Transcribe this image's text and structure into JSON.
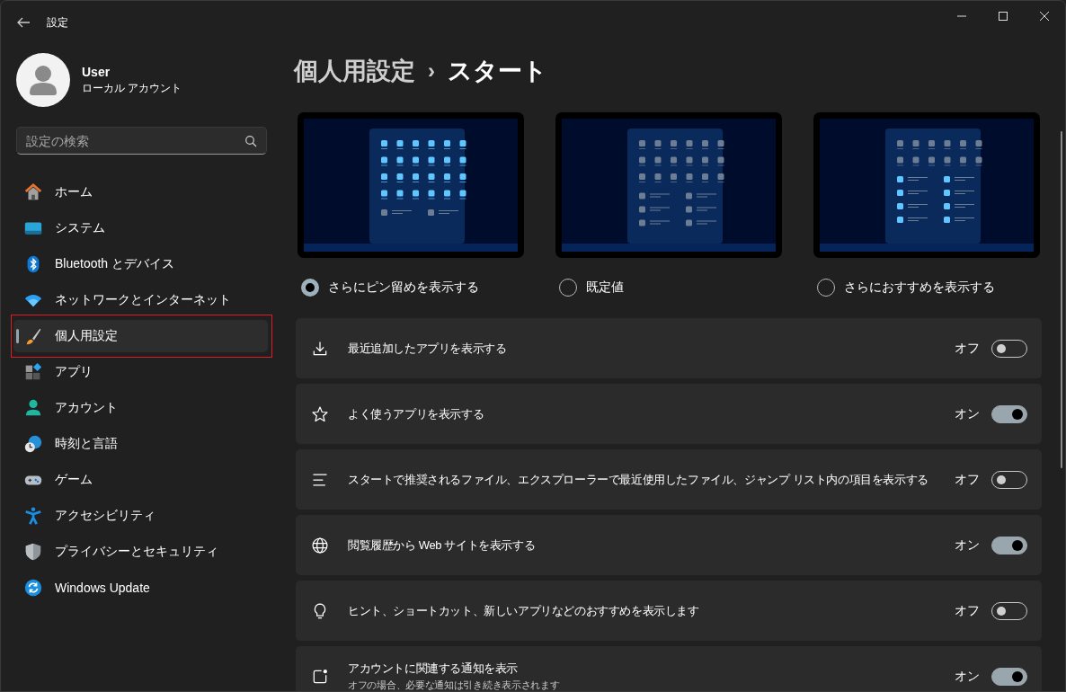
{
  "window": {
    "title": "設定"
  },
  "user": {
    "name": "User",
    "account_type": "ローカル アカウント"
  },
  "search": {
    "placeholder": "設定の検索"
  },
  "sidebar": {
    "items": [
      {
        "label": "ホーム",
        "kind": "home",
        "selected": false,
        "highlighted": false
      },
      {
        "label": "システム",
        "kind": "system",
        "selected": false,
        "highlighted": false
      },
      {
        "label": "Bluetooth とデバイス",
        "kind": "bluetooth",
        "selected": false,
        "highlighted": false
      },
      {
        "label": "ネットワークとインターネット",
        "kind": "network",
        "selected": false,
        "highlighted": false
      },
      {
        "label": "個人用設定",
        "kind": "personalize",
        "selected": true,
        "highlighted": true
      },
      {
        "label": "アプリ",
        "kind": "apps",
        "selected": false,
        "highlighted": false
      },
      {
        "label": "アカウント",
        "kind": "account",
        "selected": false,
        "highlighted": false
      },
      {
        "label": "時刻と言語",
        "kind": "time",
        "selected": false,
        "highlighted": false
      },
      {
        "label": "ゲーム",
        "kind": "game",
        "selected": false,
        "highlighted": false
      },
      {
        "label": "アクセシビリティ",
        "kind": "accessibility",
        "selected": false,
        "highlighted": false
      },
      {
        "label": "プライバシーとセキュリティ",
        "kind": "privacy",
        "selected": false,
        "highlighted": false
      },
      {
        "label": "Windows Update",
        "kind": "update",
        "selected": false,
        "highlighted": false
      }
    ]
  },
  "breadcrumb": {
    "parent": "個人用設定",
    "separator": "›",
    "current": "スタート"
  },
  "layouts": [
    {
      "label": "さらにピン留めを表示する",
      "kind": "more_pins",
      "selected": true
    },
    {
      "label": "既定値",
      "kind": "default",
      "selected": false
    },
    {
      "label": "さらにおすすめを表示する",
      "kind": "more_recs",
      "selected": false
    }
  ],
  "settings": [
    {
      "kind": "download",
      "label": "最近追加したアプリを表示する",
      "on": false,
      "state_text": "オフ"
    },
    {
      "kind": "star",
      "label": "よく使うアプリを表示する",
      "on": true,
      "state_text": "オン"
    },
    {
      "kind": "lines",
      "label": "スタートで推奨されるファイル、エクスプローラーで最近使用したファイル、ジャンプ リスト内の項目を表示する",
      "on": false,
      "state_text": "オフ"
    },
    {
      "kind": "globe",
      "label": "閲覧履歴から Web サイトを表示する",
      "on": true,
      "state_text": "オン"
    },
    {
      "kind": "bulb",
      "label": "ヒント、ショートカット、新しいアプリなどのおすすめを表示します",
      "on": false,
      "state_text": "オフ"
    },
    {
      "kind": "notify",
      "label": "アカウントに関連する通知を表示",
      "description": "オフの場合、必要な通知は引き続き表示されます",
      "on": true,
      "state_text": "オン"
    }
  ]
}
